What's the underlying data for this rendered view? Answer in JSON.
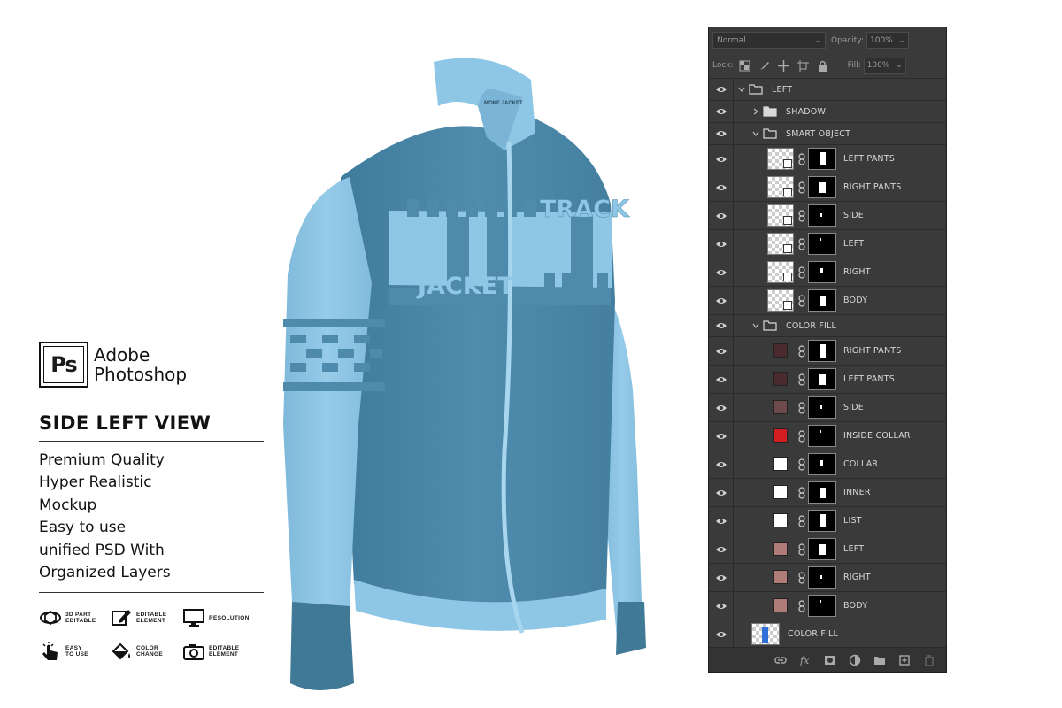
{
  "branding": {
    "logo_text": "Ps",
    "app_name_line1": "Adobe",
    "app_name_line2": "Photoshop"
  },
  "view_title": "SIDE LEFT VIEW",
  "features": [
    "Premium Quality",
    "Hyper Realistic",
    "Mockup",
    "Easy to use",
    "unified PSD With",
    "Organized Layers"
  ],
  "badges": [
    {
      "icon": "3d-part-icon",
      "line1": "3D PART",
      "line2": "EDITABLE"
    },
    {
      "icon": "edit-icon",
      "line1": "EDITABLE",
      "line2": "ELEMENT"
    },
    {
      "icon": "monitor-icon",
      "line1": "RESOLUTION",
      "line2": ""
    },
    {
      "icon": "hand-click-icon",
      "line1": "EASY",
      "line2": "TO USE"
    },
    {
      "icon": "paint-bucket-icon",
      "line1": "COLOR",
      "line2": "CHANGE"
    },
    {
      "icon": "camera-icon",
      "line1": "EDITABLE",
      "line2": "ELEMENT"
    }
  ],
  "jacket": {
    "chest_text_1": "TRACK",
    "chest_text_2": "JACKET",
    "collar_tag": "MOKE JACKET",
    "colors": {
      "light": "#8ec6e6",
      "dark": "#4d8aab",
      "cuff": "#3f7996"
    }
  },
  "ps_panel": {
    "blend_mode": "Normal",
    "opacity_label": "Opacity:",
    "opacity_value": "100%",
    "lock_label": "Lock:",
    "fill_label": "Fill:",
    "fill_value": "100%",
    "layers": [
      {
        "name": "LEFT",
        "type": "group",
        "expanded": true,
        "level": 0
      },
      {
        "name": "SHADOW",
        "type": "group",
        "expanded": false,
        "level": 1
      },
      {
        "name": "SMART OBJECT",
        "type": "group",
        "expanded": true,
        "level": 1
      },
      {
        "name": "LEFT PANTS",
        "type": "smart",
        "level": 2
      },
      {
        "name": "RIGHT PANTS",
        "type": "smart",
        "level": 2
      },
      {
        "name": "SIDE",
        "type": "smart",
        "level": 2
      },
      {
        "name": "LEFT",
        "type": "smart",
        "level": 2
      },
      {
        "name": "RIGHT",
        "type": "smart",
        "level": 2
      },
      {
        "name": "BODY",
        "type": "smart",
        "level": 2
      },
      {
        "name": "COLOR FILL",
        "type": "group",
        "expanded": true,
        "level": 1
      },
      {
        "name": "RIGHT PANTS",
        "type": "fill",
        "color": "#4a2a2c",
        "level": 2
      },
      {
        "name": "LEFT PANTS",
        "type": "fill",
        "color": "#4a2a2c",
        "level": 2
      },
      {
        "name": "SIDE",
        "type": "fill",
        "color": "#6e4a4c",
        "level": 2
      },
      {
        "name": "INSIDE COLLAR",
        "type": "fill",
        "color": "#d21e23",
        "level": 2
      },
      {
        "name": "COLLAR",
        "type": "fill",
        "color": "#ffffff",
        "level": 2
      },
      {
        "name": "INNER",
        "type": "fill",
        "color": "#ffffff",
        "level": 2
      },
      {
        "name": "LIST",
        "type": "fill",
        "color": "#ffffff",
        "level": 2
      },
      {
        "name": "LEFT",
        "type": "fill",
        "color": "#b07c78",
        "level": 2
      },
      {
        "name": "RIGHT",
        "type": "fill",
        "color": "#b07c78",
        "level": 2
      },
      {
        "name": "BODY",
        "type": "fill",
        "color": "#b07c78",
        "level": 2
      },
      {
        "name": "COLOR FILL",
        "type": "layer",
        "level": 0
      }
    ],
    "bottom_icons": [
      "link-layers-icon",
      "fx-icon",
      "add-mask-icon",
      "adjustment-layer-icon",
      "new-group-icon",
      "new-layer-icon",
      "trash-icon"
    ]
  }
}
